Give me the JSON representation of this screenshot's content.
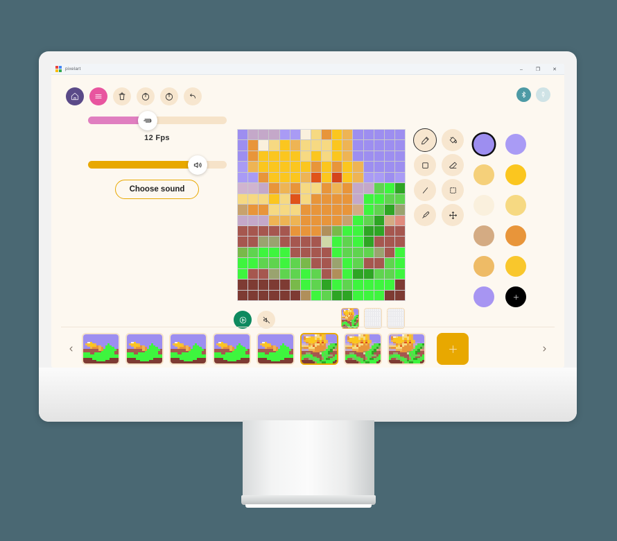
{
  "window": {
    "title": "pixelart",
    "logo_icon": "google-colored-squares-logo",
    "controls": [
      {
        "name": "minimize",
        "glyph": "–"
      },
      {
        "name": "maximize",
        "glyph": "❐"
      },
      {
        "name": "close",
        "glyph": "✕"
      }
    ]
  },
  "toolbar": {
    "buttons": [
      {
        "name": "home-button",
        "icon": "home-icon",
        "label": "Home",
        "style": "home"
      },
      {
        "name": "menu-button",
        "icon": "hamburger-menu-icon",
        "label": "Menu",
        "style": "menu"
      },
      {
        "name": "delete-button",
        "icon": "trash-icon",
        "label": "Delete",
        "style": "plain"
      },
      {
        "name": "flip-button",
        "icon": "flip-vertical-icon",
        "label": "Flip",
        "style": "plain"
      },
      {
        "name": "rotate-button",
        "icon": "rotate-icon",
        "label": "Rotate",
        "style": "plain"
      },
      {
        "name": "undo-button",
        "icon": "undo-arrow-icon",
        "label": "Undo",
        "style": "plain"
      }
    ]
  },
  "connectivity": {
    "bluetooth": {
      "name": "bluetooth-toggle",
      "icon": "bluetooth-icon",
      "state": "on",
      "color": "#4d9aa5"
    },
    "usb": {
      "name": "usb-toggle",
      "icon": "usb-plug-icon",
      "state": "off",
      "color": "#cfe3e6"
    }
  },
  "left_panel": {
    "fps_slider": {
      "name": "fps-slider",
      "value": 12,
      "percent": 43,
      "label": "12 Fps",
      "fill_color": "#e07fc0",
      "track_color": "#f6e3c9",
      "knob_icon": "speed-lines-icon"
    },
    "volume_slider": {
      "name": "volume-slider",
      "percent": 79,
      "fill_color": "#e8a800",
      "track_color": "#f6e3c9",
      "knob_icon": "speaker-volume-icon"
    },
    "choose_sound_button": {
      "name": "choose-sound-button",
      "label": "Choose sound",
      "border_color": "#e8a800"
    }
  },
  "tools": [
    {
      "name": "pencil-tool",
      "icon": "pencil-icon",
      "label": "Pencil",
      "selected": true
    },
    {
      "name": "fill-tool",
      "icon": "paint-bucket-icon",
      "label": "Fill",
      "selected": false
    },
    {
      "name": "rectangle-tool",
      "icon": "rectangle-icon",
      "label": "Rectangle",
      "selected": false
    },
    {
      "name": "eraser-tool",
      "icon": "eraser-icon",
      "label": "Eraser",
      "selected": false
    },
    {
      "name": "line-tool",
      "icon": "line-icon",
      "label": "Line",
      "selected": false
    },
    {
      "name": "select-tool",
      "icon": "marquee-select-icon",
      "label": "Select",
      "selected": false
    },
    {
      "name": "eyedropper-tool",
      "icon": "eyedropper-icon",
      "label": "Color picker",
      "selected": false
    },
    {
      "name": "move-tool",
      "icon": "move-cross-icon",
      "label": "Move",
      "selected": false
    }
  ],
  "palette": {
    "selected_index": 0,
    "swatches": [
      {
        "name": "swatch-periwinkle",
        "color": "#9d8ef0"
      },
      {
        "name": "swatch-light-periwinkle",
        "color": "#a99bf5"
      },
      {
        "name": "swatch-pale-gold",
        "color": "#f5d07a"
      },
      {
        "name": "swatch-amber",
        "color": "#fbc61f"
      },
      {
        "name": "swatch-cream",
        "color": "#faf0dd"
      },
      {
        "name": "swatch-light-gold",
        "color": "#f6d982"
      },
      {
        "name": "swatch-tan",
        "color": "#d4ab83"
      },
      {
        "name": "swatch-orange",
        "color": "#e8953a"
      },
      {
        "name": "swatch-sand",
        "color": "#eebb66"
      },
      {
        "name": "swatch-yellow",
        "color": "#f9c72c"
      },
      {
        "name": "swatch-lavender",
        "color": "#a795f2"
      },
      {
        "name": "swatch-add-color",
        "color": "#000000",
        "icon": "plus-icon",
        "is_add": true
      }
    ]
  },
  "playback": {
    "play_button": {
      "name": "play-button",
      "icon": "play-triangle-icon",
      "label": "Play",
      "color": "#0e8a5f"
    },
    "mute_button": {
      "name": "mute-button",
      "icon": "speaker-muted-icon",
      "label": "Mute",
      "color": "#f7e6cf"
    }
  },
  "layers": [
    {
      "name": "layer-thumb-1",
      "active": true,
      "empty": false
    },
    {
      "name": "layer-thumb-2",
      "active": false,
      "empty": true
    },
    {
      "name": "layer-thumb-3",
      "active": false,
      "empty": true
    }
  ],
  "framestrip": {
    "prev_arrow": {
      "name": "prev-frames-arrow",
      "icon": "chevron-left-icon",
      "glyph": "‹"
    },
    "next_arrow": {
      "name": "next-frames-arrow",
      "icon": "chevron-right-icon",
      "glyph": "›"
    },
    "add_frame": {
      "name": "add-frame-button",
      "icon": "plus-icon",
      "label": "Add frame",
      "color": "#e8a800"
    },
    "active_frame_index": 5,
    "frame_count": 9
  },
  "chart_data": {
    "type": "heatmap",
    "title": "16x16 pixel art canvas - sunflower",
    "rows": 16,
    "cols": 16,
    "palette_key": {
      "P": "#9d8ef0",
      "p": "#a99bf5",
      "m": "#c4a8c9",
      "M": "#d0b4cf",
      "C": "#faf0dd",
      "Y": "#fbc61f",
      "y": "#f6d982",
      "O": "#e8953a",
      "o": "#eeb454",
      "R": "#e0531a",
      "r": "#d4451c",
      "G": "#3ef53e",
      "g": "#5fd44f",
      "D": "#2ea524",
      "d": "#79b94a",
      "B": "#a6574f",
      "b": "#7e3b33",
      "T": "#d4ab83",
      "k": "#c8a26d",
      "s": "#cfd8a8",
      "n": "#9aa36f",
      "e": "#e08b7d",
      "z": "#b08f5a"
    },
    "grid": [
      "PmmmppCyOYoPPPPP",
      "POCyYoyyyYoPPPPP",
      "POYYYYyYyYoPPPPP",
      "poYYYYYOYOYoPPPP",
      "ppOYYYoRYrYoppPp",
      "MMmOoOyyOoOmmgGD",
      "yyyYyRyOOOOmGGgg",
      "kOOyyyOOOOOTGgDn",
      "mmmoooOOOOkGgDTe",
      "BBBBBOOOzdGGDDBB",
      "BBnnBBBBsGgGDBBB",
      "dgGGGBBBBGgggnBG",
      "GGggGgdBBnGgBBgG",
      "GBBnggGgBzGDDggG",
      "bbbbbdGgDGgGGGGb",
      "bbbbbbzGgDDGGGbb"
    ],
    "frame_thumbnails": [
      {
        "index": 0,
        "grid": [
          "PPPPPPPPPPPPPPPP",
          "PPPPPPPPPPPPPPPP",
          "PPPPPPPPPPPPPPPP",
          "PPPPPPPPPPPPPPPP",
          "PPCYPPPPPPPPPPPP",
          "PoYYYoPPPPPGPPPP",
          "PPoYYYOoPPGGGPPP",
          "PPPoOOOoOPGGGGPP",
          "BBBBBBBoOGGGGGGB",
          "BBBBBBBBGGGGGGBB",
          "GGGBBGGGGGGGGGBB",
          "GGGGGGGGGGGGGGGG",
          "GGGGGGGGGGGGGGGG",
          "bbbbGGGGGGGGbbbb",
          "bbbbbbGGGGbbbbbb",
          "bbbbbbbbbbbbbbbb"
        ]
      },
      {
        "index": 1,
        "same_as": 0
      },
      {
        "index": 2,
        "same_as": 0
      },
      {
        "index": 3,
        "same_as": 0
      },
      {
        "index": 4,
        "same_as": 0
      },
      {
        "index": 5,
        "active": true,
        "zoomed": true
      },
      {
        "index": 6,
        "zoomed": true
      },
      {
        "index": 7,
        "zoomed": true
      }
    ]
  }
}
